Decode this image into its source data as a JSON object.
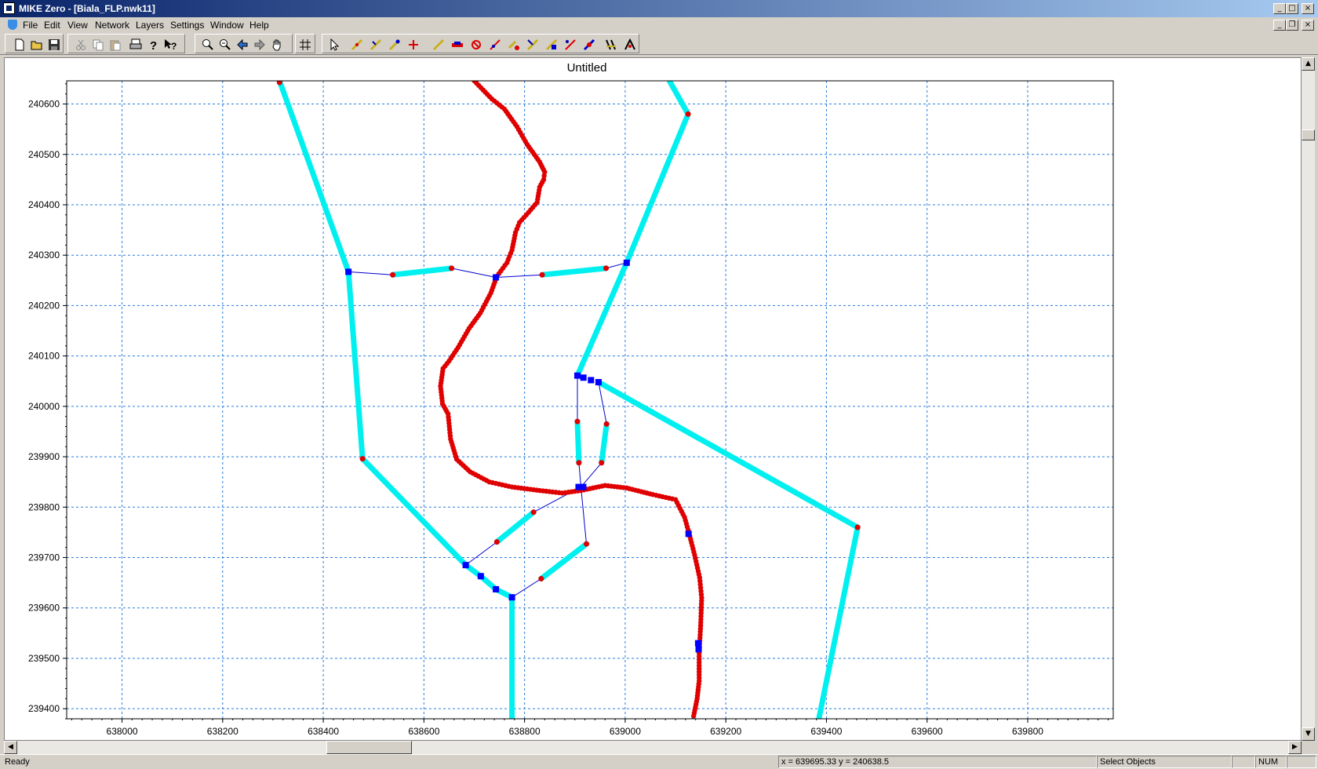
{
  "window": {
    "title": "MIKE Zero - [Biala_FLP.nwk11]"
  },
  "menu": [
    "File",
    "Edit",
    "View",
    "Network",
    "Layers",
    "Settings",
    "Window",
    "Help"
  ],
  "toolbar": {
    "groups": [
      [
        "new-file-icon",
        "open-folder-icon",
        "save-icon"
      ],
      [
        "cut-icon",
        "copy-icon",
        "paste-icon",
        "print-icon",
        "help-icon",
        "context-help-icon"
      ],
      [
        "zoom-in-icon",
        "zoom-out-icon",
        "zoom-previous-icon",
        "zoom-next-icon",
        "pan-hand-icon"
      ],
      [
        "grid-toggle-icon"
      ],
      [
        "select-arrow-icon",
        "add-point-icon",
        "add-branch-icon",
        "connect-branch-icon",
        "disconnect-branch-icon",
        "draw-line-icon",
        "add-structure-icon",
        "delete-point-icon",
        "merge-point-icon",
        "move-point-icon",
        "split-branch-icon",
        "reverse-branch-icon",
        "edit-properties-icon",
        "link-icon",
        "find-icon",
        "query-icon"
      ]
    ]
  },
  "plot": {
    "title": "Untitled",
    "x_ticks": [
      "638000",
      "638200",
      "638400",
      "638600",
      "638800",
      "639000",
      "639200",
      "639400",
      "639600",
      "639800"
    ],
    "y_ticks": [
      "240600",
      "240500",
      "240400",
      "240300",
      "240200",
      "240100",
      "240000",
      "239900",
      "239800",
      "239700",
      "239600",
      "239500",
      "239400"
    ],
    "xlim": [
      637890,
      639970
    ],
    "ylim": [
      239380,
      240646
    ],
    "grid": true,
    "colors": {
      "channel": "#00f0f0",
      "river": "#e00000",
      "node": "#0000ff",
      "link": "#0000cc",
      "grid": "#2a7dde"
    }
  },
  "network": {
    "cyan_channels": [
      [
        [
          638313,
          240646
        ],
        [
          638450,
          240267
        ],
        [
          638478,
          239896
        ],
        [
          638683,
          239685
        ],
        [
          638713,
          239663
        ],
        [
          638743,
          239637
        ],
        [
          638775,
          239621
        ],
        [
          638775,
          239380
        ]
      ],
      [
        [
          639088,
          240646
        ],
        [
          639125,
          240580
        ],
        [
          639003,
          240285
        ],
        [
          638905,
          240061
        ]
      ],
      [
        [
          638947,
          240048
        ],
        [
          639462,
          239760
        ],
        [
          639385,
          239380
        ]
      ],
      [
        [
          638538,
          240261
        ],
        [
          638655,
          240274
        ]
      ],
      [
        [
          638835,
          240261
        ],
        [
          638962,
          240274
        ]
      ],
      [
        [
          638905,
          239970
        ],
        [
          638908,
          239888
        ]
      ],
      [
        [
          638963,
          239965
        ],
        [
          638953,
          239888
        ]
      ],
      [
        [
          638745,
          239731
        ],
        [
          638818,
          239790
        ]
      ],
      [
        [
          638833,
          239658
        ],
        [
          638923,
          239727
        ]
      ]
    ],
    "river": [
      [
        638700,
        240646
      ],
      [
        638735,
        240610
      ],
      [
        638760,
        240590
      ],
      [
        638785,
        240555
      ],
      [
        638805,
        240520
      ],
      [
        638830,
        240485
      ],
      [
        638840,
        240465
      ],
      [
        638838,
        240450
      ],
      [
        638830,
        240435
      ],
      [
        638825,
        240405
      ],
      [
        638808,
        240385
      ],
      [
        638790,
        240365
      ],
      [
        638782,
        240345
      ],
      [
        638775,
        240310
      ],
      [
        638765,
        240285
      ],
      [
        638745,
        240258
      ],
      [
        638733,
        240225
      ],
      [
        638712,
        240185
      ],
      [
        638690,
        240155
      ],
      [
        638668,
        240117
      ],
      [
        638650,
        240090
      ],
      [
        638638,
        240075
      ],
      [
        638633,
        240040
      ],
      [
        638637,
        240005
      ],
      [
        638648,
        239985
      ],
      [
        638653,
        239935
      ],
      [
        638665,
        239895
      ],
      [
        638692,
        239870
      ],
      [
        638730,
        239850
      ],
      [
        638775,
        239840
      ],
      [
        638830,
        239833
      ],
      [
        638875,
        239828
      ],
      [
        638912,
        239833
      ],
      [
        638960,
        239843
      ],
      [
        639003,
        239838
      ],
      [
        639055,
        239825
      ],
      [
        639100,
        239815
      ],
      [
        639118,
        239780
      ],
      [
        639127,
        239748
      ],
      [
        639138,
        239705
      ],
      [
        639148,
        239660
      ],
      [
        639152,
        239620
      ],
      [
        639150,
        239565
      ],
      [
        639147,
        239510
      ],
      [
        639147,
        239455
      ],
      [
        639143,
        239420
      ],
      [
        639135,
        239380
      ]
    ],
    "river_nodes": [
      [
        639126,
        239747
      ],
      [
        639145,
        239530
      ],
      [
        639146,
        239518
      ]
    ],
    "hub": [
      638912,
      239840
    ],
    "nodes": [
      [
        638450,
        240267
      ],
      [
        638743,
        240256
      ],
      [
        639003,
        240285
      ],
      [
        638905,
        240061
      ],
      [
        638917,
        240057
      ],
      [
        638932,
        240052
      ],
      [
        638947,
        240048
      ],
      [
        638683,
        239685
      ],
      [
        638713,
        239663
      ],
      [
        638743,
        239637
      ],
      [
        638775,
        239621
      ]
    ],
    "red_points": [
      [
        638313,
        240646
      ],
      [
        639125,
        240580
      ],
      [
        638478,
        239896
      ],
      [
        639462,
        239760
      ],
      [
        638538,
        240261
      ],
      [
        638655,
        240274
      ],
      [
        638835,
        240261
      ],
      [
        638962,
        240274
      ],
      [
        638905,
        239970
      ],
      [
        638908,
        239888
      ],
      [
        638963,
        239965
      ],
      [
        638953,
        239888
      ],
      [
        638745,
        239731
      ],
      [
        638818,
        239790
      ],
      [
        638833,
        239658
      ],
      [
        638923,
        239727
      ]
    ],
    "links": [
      [
        [
          638450,
          240267
        ],
        [
          638538,
          240261
        ]
      ],
      [
        [
          638655,
          240274
        ],
        [
          638743,
          240256
        ]
      ],
      [
        [
          638743,
          240256
        ],
        [
          638835,
          240261
        ]
      ],
      [
        [
          638962,
          240274
        ],
        [
          639003,
          240285
        ]
      ],
      [
        [
          638905,
          240061
        ],
        [
          638905,
          239970
        ]
      ],
      [
        [
          638947,
          240048
        ],
        [
          638963,
          239965
        ]
      ],
      [
        [
          638908,
          239888
        ],
        [
          638912,
          239840
        ]
      ],
      [
        [
          638953,
          239888
        ],
        [
          638912,
          239840
        ]
      ],
      [
        [
          638912,
          239840
        ],
        [
          638818,
          239790
        ]
      ],
      [
        [
          638912,
          239840
        ],
        [
          638923,
          239727
        ]
      ],
      [
        [
          638745,
          239731
        ],
        [
          638683,
          239685
        ]
      ],
      [
        [
          638833,
          239658
        ],
        [
          638775,
          239621
        ]
      ]
    ]
  },
  "status": {
    "ready": "Ready",
    "coords": "x = 639695.33  y = 240638.5",
    "mode": "Select Objects",
    "num": "NUM"
  }
}
